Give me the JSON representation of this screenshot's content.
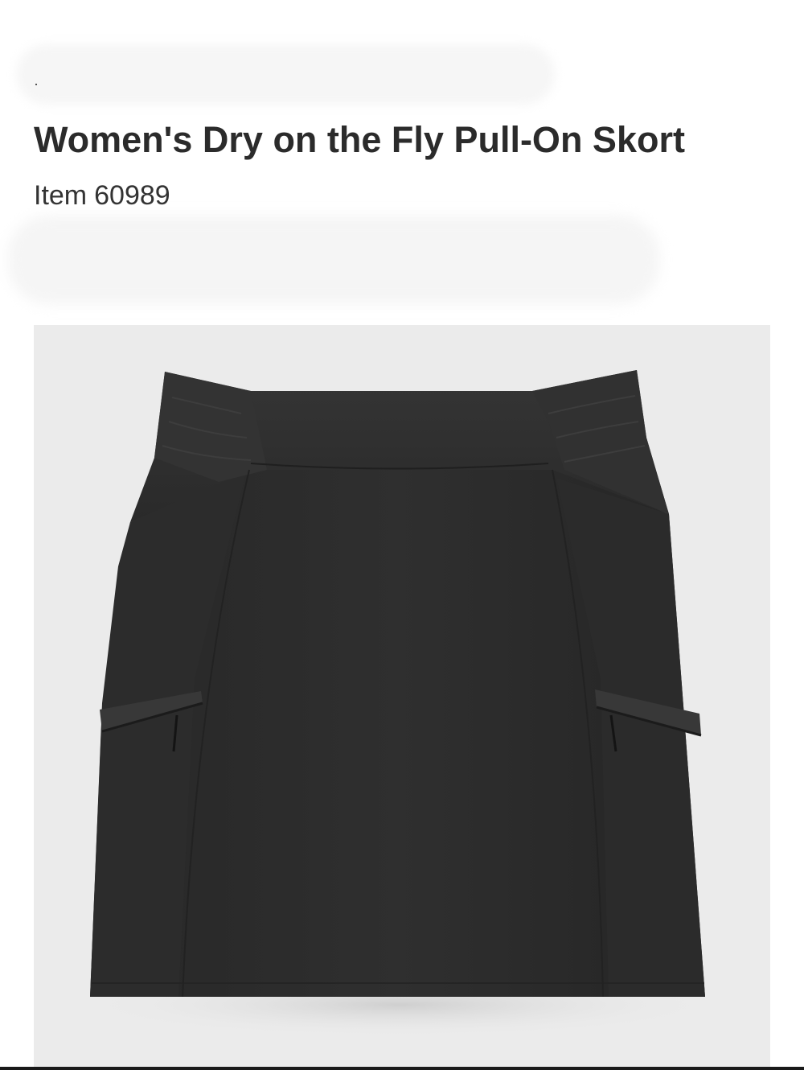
{
  "product": {
    "title": "Women's Dry on the Fly Pull-On Skort",
    "item_label": "Item",
    "item_number": "60989"
  },
  "image": {
    "icon": "skort-product-photo",
    "background_color": "#ebebeb",
    "garment_color": "#2d2d2d"
  }
}
